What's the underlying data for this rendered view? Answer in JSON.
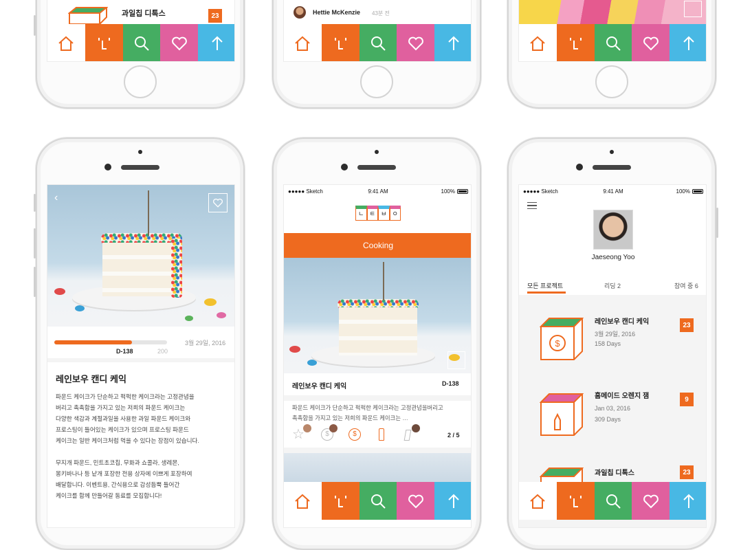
{
  "colors": {
    "orange": "#ee6a1f",
    "green": "#45ad62",
    "pink": "#e0609e",
    "blue": "#48b8e4"
  },
  "tabbar": {
    "items": [
      "home-icon",
      "brand-icon",
      "search-icon",
      "heart-icon",
      "arrow-up-icon"
    ]
  },
  "top_left": {
    "project_title": "과일칩 디톡스",
    "badge": "23"
  },
  "top_middle": {
    "author": "Hettie McKenzie",
    "time": "43분 전"
  },
  "detail": {
    "progress_label": "D-138",
    "progress_max": "200",
    "progress_fraction": 0.69,
    "date": "3월 29일, 2016",
    "title": "레인보우 캔디 케익",
    "desc1": "파운드 케이크가 단순하고 퍽퍽한 케이크라는 고정관념을",
    "desc2": "버리고 촉촉함을 가지고 있는 저희의 파운드 케이크는",
    "desc3": "다양한 색감과 계절과일을 사용한 과일 파운드 케이크와",
    "desc4": "프로스팅이 들어있는 케이크가 있으며 프로스팅 파운드",
    "desc5": "케이크는 일반 케이크처럼 먹을 수 있다는 장점이 있습니다.",
    "desc6": "무지개 파운드, 민트초코칩, 무화과 쇼콜라, 생레몬,",
    "desc7": "몽키바나나 등 낱개 포장한 전용 상자에 이쁘게 포장하여",
    "desc8": "배달합니다. 이벤트용, 간식용으로 감성듬뿍 들어간",
    "desc9": "케이크를 함께 만들어갈 동료를 모집합니다!"
  },
  "status": {
    "carrier": "●●●●● Sketch",
    "time": "9:41 AM",
    "battery": "100%"
  },
  "feed": {
    "logo_letters": [
      "ㄴ",
      "ㅌ",
      "ㅂ",
      "ㅇ"
    ],
    "category": "Cooking",
    "card_title": "레인보우 캔디 케익",
    "card_dday": "D-138",
    "card_desc1": "파운드 케이크가 단순하고 퍽퍽한 케이크라는 고정관념을버리고",
    "card_desc2": "촉촉함을 가지고 있는 저희의 파운드 케이크는 …",
    "pager": "2 / 5"
  },
  "profile": {
    "name": "Jaeseong Yoo",
    "tabs": [
      "모든 프로젝트",
      "리딩 2",
      "참여 중 6"
    ],
    "projects": [
      {
        "title": "레인보우 캔디 케익",
        "date": "3월 29일, 2016",
        "days": "158 Days",
        "badge": "23"
      },
      {
        "title": "홈메이드 오렌지 잼",
        "date": "Jan 03, 2016",
        "days": "309 Days",
        "badge": "9"
      },
      {
        "title": "과일칩 디톡스",
        "date": "",
        "days": "",
        "badge": "23"
      }
    ]
  }
}
